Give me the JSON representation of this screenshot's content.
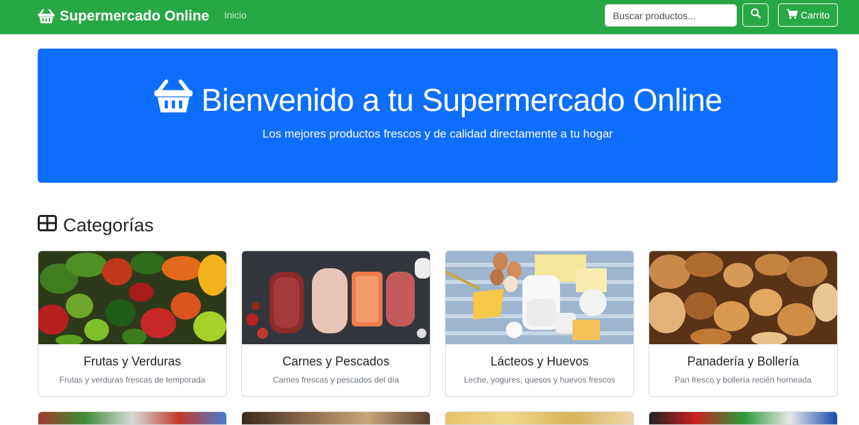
{
  "navbar": {
    "brand": "Supermercado Online",
    "links": [
      "Inicio"
    ],
    "search_placeholder": "Buscar productos...",
    "cart_label": "Carrito",
    "background": "#28a745"
  },
  "hero": {
    "title": "Bienvenido a tu Supermercado Online",
    "subtitle": "Los mejores productos frescos y de calidad directamente a tu hogar",
    "background": "#0d6efd"
  },
  "categories_section": {
    "title": "Categorías",
    "cards": [
      {
        "title": "Frutas y Verduras",
        "text": "Frutas y verduras frescas de temporada",
        "image": "fruits-vegetables"
      },
      {
        "title": "Carnes y Pescados",
        "text": "Carnes frescas y pescados del día",
        "image": "meat-fish"
      },
      {
        "title": "Lácteos y Huevos",
        "text": "Leche, yogures, quesos y huevos frescos",
        "image": "dairy-eggs"
      },
      {
        "title": "Panadería y Bollería",
        "text": "Pan fresco y bollería recién horneada",
        "image": "bakery"
      }
    ]
  }
}
